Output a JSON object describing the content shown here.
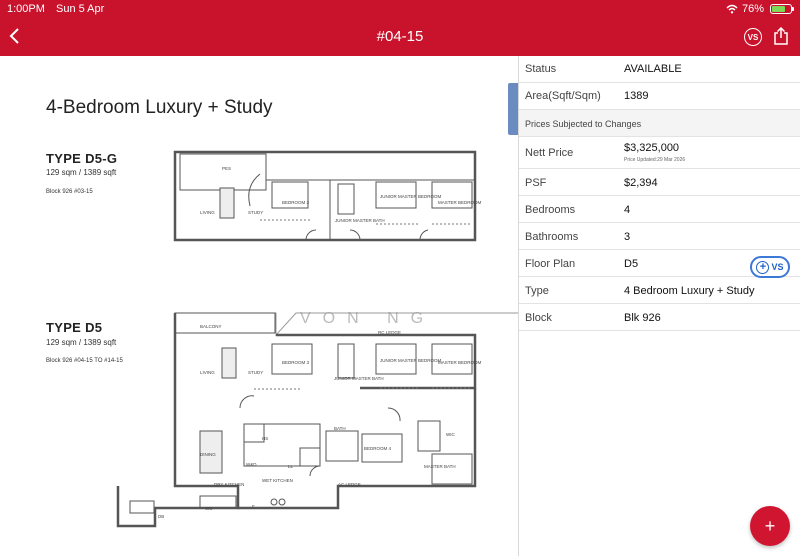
{
  "status_bar": {
    "time": "1:00PM",
    "date": "Sun 5 Apr",
    "battery": "76%"
  },
  "nav": {
    "title": "#04-15",
    "back_icon": "chevron-left-icon",
    "compare_label": "VS",
    "share_icon": "share-icon"
  },
  "plan": {
    "heading": "4-Bedroom Luxury + Study",
    "plans": [
      {
        "type": "TYPE D5-G",
        "size": "129 sqm / 1389 sqft",
        "block": "Block 926  #03-15"
      },
      {
        "type": "TYPE D5",
        "size": "129 sqm / 1389 sqft",
        "block": "Block 926  #04-15 TO #14-15"
      }
    ],
    "watermark": "VON NG",
    "room_labels": {
      "pes": "PES",
      "living": "LIVING",
      "study": "STUDY",
      "bedroom3": "BEDROOM 3",
      "junior_master": "JUNIOR MASTER BEDROOM",
      "master": "MASTER BEDROOM",
      "junior_bath": "JUNIOR MASTER BATH",
      "balcony": "BALCONY",
      "rc_ledge": "RC LEDGE",
      "dining": "DINING",
      "wet_kitchen": "WET KITCHEN",
      "dry_kitchen": "DRY KITCHEN",
      "bedroom4": "BEDROOM 4",
      "bath": "BATH",
      "master_bath": "MASTER BATH",
      "ac_ledge": "AC LEDGE",
      "hs": "HS",
      "wic": "WIC",
      "ws": "W&D",
      "db": "DB",
      "wc": "WC",
      "f": "F",
      "ll": "LL"
    }
  },
  "details": {
    "rows": [
      {
        "key": "Status",
        "value": "AVAILABLE"
      },
      {
        "key": "Area(Sqft/Sqm)",
        "value": "1389"
      }
    ],
    "notice": "Prices Subjected to Changes",
    "price": {
      "key": "Nett Price",
      "value": "$3,325,000",
      "note": "Price Updated:29 Mar 2026"
    },
    "rows2": [
      {
        "key": "PSF",
        "value": "$2,394"
      },
      {
        "key": "Bedrooms",
        "value": "4"
      },
      {
        "key": "Bathrooms",
        "value": "3"
      },
      {
        "key": "Floor Plan",
        "value": "D5"
      },
      {
        "key": "Type",
        "value": "4 Bedroom Luxury + Study"
      },
      {
        "key": "Block",
        "value": "Blk 926"
      }
    ]
  },
  "compare_pill": {
    "label": "VS",
    "icon": "plus-circle-icon"
  },
  "fab": {
    "label": "+",
    "icon": "plus-icon"
  },
  "colors": {
    "brand": "#c9132d",
    "accent": "#3c78d8",
    "fab": "#d01530"
  }
}
